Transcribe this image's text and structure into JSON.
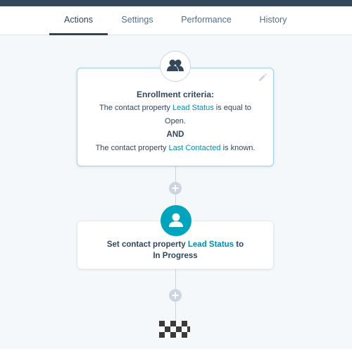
{
  "tabs": [
    {
      "label": "Actions",
      "active": true
    },
    {
      "label": "Settings",
      "active": false
    },
    {
      "label": "Performance",
      "active": false
    },
    {
      "label": "History",
      "active": false
    }
  ],
  "trigger": {
    "icon": "contacts-icon",
    "title": "Enrollment criteria:",
    "line1_prefix": "The contact property",
    "line1_property": "Lead Status",
    "line1_suffix": "is equal to",
    "line2": "Open.",
    "conjunction": "AND",
    "line3_prefix": "The contact property",
    "line3_property": "Last Contacted",
    "line3_suffix": "is known."
  },
  "action": {
    "icon": "contact-icon",
    "prefix": "Set contact property",
    "property": "Lead Status",
    "suffix": "to In Progress"
  },
  "colors": {
    "topbar": "#33475b",
    "link": "#0091ae",
    "action_icon_bg": "#00a4bd",
    "connector": "#cbd6e2"
  }
}
